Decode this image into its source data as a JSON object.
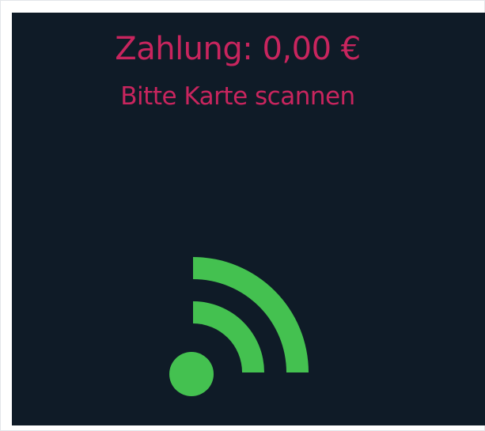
{
  "payment": {
    "label": "Zahlung:",
    "amount": "0,00 €",
    "instruction": "Bitte Karte scannen"
  },
  "icons": {
    "contactless": "nfc-signal-icon"
  },
  "colors": {
    "background": "#0f1b27",
    "accent_text": "#c8255e",
    "signal": "#44c150",
    "frame": "#ffffff"
  }
}
